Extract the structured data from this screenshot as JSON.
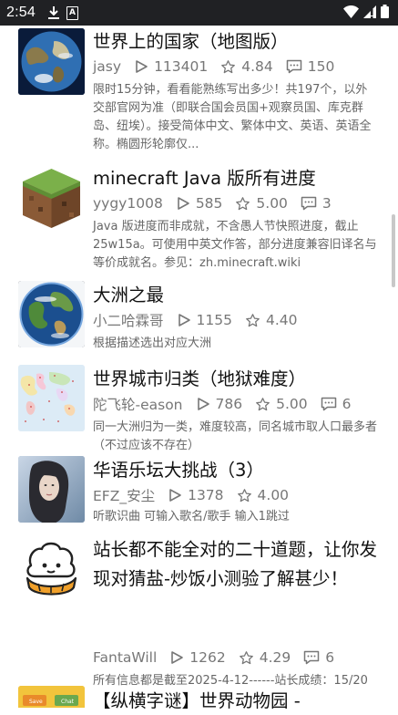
{
  "status_bar": {
    "time": "2:54",
    "a_label": "A"
  },
  "items": [
    {
      "title": "世界上的国家（地图版）",
      "author": "jasy",
      "plays": "113401",
      "rating": "4.84",
      "comments": "150",
      "desc": "限时15分钟，看看能熟练写出多少！共197个，以外交部官网为准（即联合国会员国+观察员国、库克群岛、纽埃）。接受简体中文、繁体中文、英语、英语全称。椭圆形轮廓仅..."
    },
    {
      "title": "minecraft Java 版所有进度",
      "author": "yygy1008",
      "plays": "585",
      "rating": "5.00",
      "comments": "3",
      "desc": "Java 版进度而非成就，不含愚人节快照进度，截止 25w15a。可使用中英文作答，部分进度兼容旧译名与等价成就名。参见：zh.minecraft.wiki"
    },
    {
      "title": "大洲之最",
      "author": "小二哈霖哥",
      "plays": "1155",
      "rating": "4.40",
      "comments": "",
      "desc": "根据描述选出对应大洲"
    },
    {
      "title": "世界城市归类（地狱难度）",
      "author": "陀飞轮-eason",
      "plays": "786",
      "rating": "5.00",
      "comments": "6",
      "desc": "同一大洲归为一类，难度较高，同名城市取人口最多者（不过应该不存在）"
    },
    {
      "title": "华语乐坛大挑战（3）",
      "author": "EFZ_安尘",
      "plays": "1378",
      "rating": "4.00",
      "comments": "",
      "desc": "听歌识曲 可输入歌名/歌手 输入1跳过"
    },
    {
      "title": "站长都不能全对的二十道题，让你发现对猜盐-炒饭小测验了解甚少！",
      "author": "FantaWill",
      "plays": "1262",
      "rating": "4.29",
      "comments": "6",
      "desc": "所有信息都是截至2025-4-12------站长成绩：15/20"
    },
    {
      "title": "【纵横字谜】世界动物园 -",
      "thumb_labels": [
        "Save",
        "Chat"
      ]
    }
  ]
}
